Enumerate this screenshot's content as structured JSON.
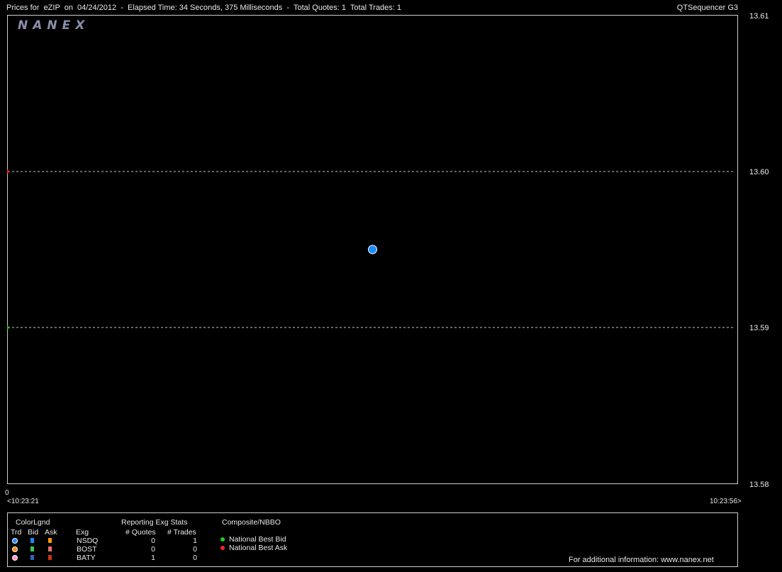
{
  "header": {
    "title": "Prices for  eZIP  on  04/24/2012  -  Elapsed Time: 34 Seconds, 375 Milliseconds  -  Total Quotes: 1  Total Trades: 1",
    "app_name": "QTSequencer G3"
  },
  "logo": "NANEX",
  "chart_data": {
    "type": "scatter",
    "ylim": [
      13.58,
      13.61
    ],
    "y_ticks": [
      "13.61",
      "13.60",
      "13.59",
      "13.58"
    ],
    "x_start_label": "<10:23:21",
    "x_end_label": "10:23:56>",
    "x_origin_label": "0",
    "nbbo_bid": 13.59,
    "nbbo_ask": 13.6,
    "trade_point": {
      "y": 13.595,
      "x_frac": 0.5
    },
    "colors": {
      "bid": "#22cc22",
      "ask": "#ff2222",
      "trade": "#1a8cff"
    }
  },
  "legend": {
    "colorlgnd_title": "ColorLgnd",
    "col_trd": "Trd",
    "col_bid": "Bid",
    "col_ask": "Ask",
    "col_exg": "Exg",
    "stats_title": "Reporting Exg Stats",
    "col_quotes": "# Quotes",
    "col_trades": "# Trades",
    "composite_title": "Composite/NBBO",
    "nbbo_bid_label": "National Best Bid",
    "nbbo_ask_label": "National Best Ask",
    "footer": "For additional information: www.nanex.net",
    "rows": [
      {
        "exg": "NSDQ",
        "quotes": "0",
        "trades": "1",
        "trd_color": "#1a8cff",
        "bid_color": "#1a8cff",
        "ask_color": "#ff9900"
      },
      {
        "exg": "BOST",
        "quotes": "0",
        "trades": "0",
        "trd_color": "#ff8800",
        "bid_color": "#33cc55",
        "ask_color": "#e87070"
      },
      {
        "exg": "BATY",
        "quotes": "1",
        "trades": "0",
        "trd_color": "#ff99cc",
        "bid_color": "#3366bb",
        "ask_color": "#cc3311"
      }
    ]
  }
}
